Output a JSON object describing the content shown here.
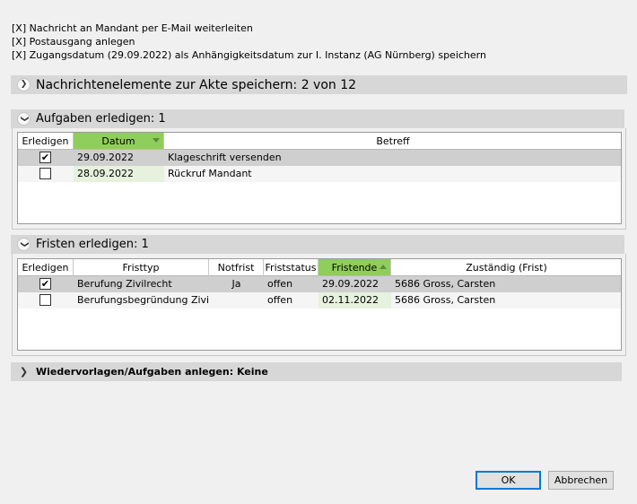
{
  "info_lines": [
    "[X] Nachricht an Mandant per E-Mail weiterleiten",
    "[X] Postausgang anlegen",
    "[X] Zugangsdatum (29.09.2022) als Anhängigkeitsdatum zur I. Instanz (AG Nürnberg) speichern"
  ],
  "sections": {
    "nachrichten": {
      "title": "Nachrichtenelemente zur Akte speichern: 2 von 12",
      "icon": "chevron-right-icon"
    },
    "aufgaben": {
      "title": "Aufgaben erledigen: 1",
      "icon": "chevron-down-icon"
    },
    "fristen": {
      "title": "Fristen erledigen: 1",
      "icon": "chevron-down-icon"
    },
    "wiedervorlagen": {
      "title": "Wiedervorlagen/Aufgaben anlegen: Keine",
      "icon": "chevron-right-icon"
    }
  },
  "aufgaben_table": {
    "headers": {
      "erledigen": "Erledigen",
      "datum": "Datum",
      "betreff": "Betreff"
    },
    "rows": [
      {
        "checked": true,
        "datum": "29.09.2022",
        "betreff": "Klageschrift versenden"
      },
      {
        "checked": false,
        "datum": "28.09.2022",
        "betreff": "Rückruf Mandant"
      }
    ]
  },
  "fristen_table": {
    "headers": {
      "erledigen": "Erledigen",
      "fristtyp": "Fristtyp",
      "notfrist": "Notfrist",
      "fristtatus": "Friststatus",
      "fristende": "Fristende",
      "zustaendig": "Zuständig (Frist)"
    },
    "rows": [
      {
        "checked": true,
        "fristtyp": "Berufung Zivilrecht",
        "notfrist": "Ja",
        "status": "offen",
        "fristende": "29.09.2022",
        "zustaendig": "5686 Gross, Carsten"
      },
      {
        "checked": false,
        "fristtyp": "Berufungsbegründung  Zivil...",
        "notfrist": "",
        "status": "offen",
        "fristende": "02.11.2022",
        "zustaendig": "5686 Gross, Carsten"
      }
    ]
  },
  "buttons": {
    "ok": "OK",
    "cancel": "Abbrechen"
  },
  "colors": {
    "sorted_header": "#8fce5a",
    "section_bar": "#d7d7d7",
    "selected_row": "#cfcfcf",
    "default_button_border": "#0078d7"
  }
}
